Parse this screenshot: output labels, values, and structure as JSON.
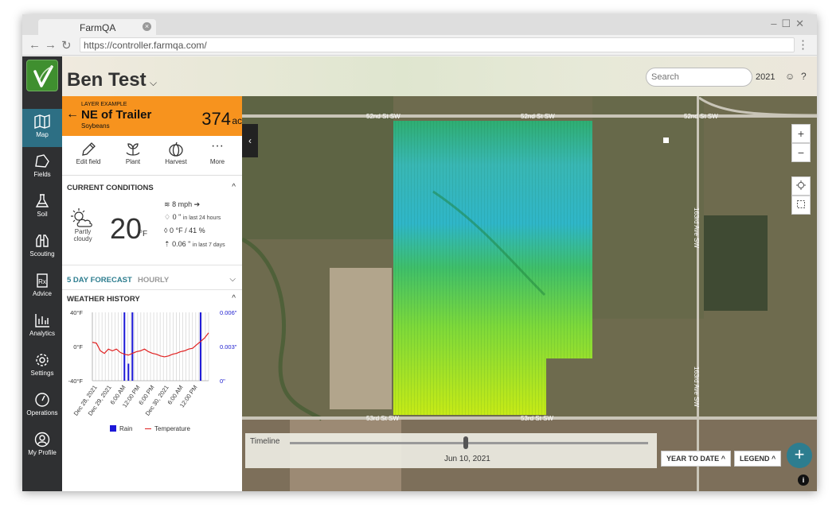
{
  "browser": {
    "tab_title": "FarmQA",
    "url": "https://controller.farmqa.com/"
  },
  "sidebar": {
    "items": [
      {
        "label": "Map",
        "icon": "map-icon",
        "active": true
      },
      {
        "label": "Fields",
        "icon": "fields-icon"
      },
      {
        "label": "Soil",
        "icon": "flask-icon"
      },
      {
        "label": "Scouting",
        "icon": "binoculars-icon"
      },
      {
        "label": "Advice",
        "icon": "prescription-icon"
      },
      {
        "label": "Analytics",
        "icon": "bar-chart-icon"
      },
      {
        "label": "Settings",
        "icon": "gear-icon"
      },
      {
        "label": "Operations",
        "icon": "gauge-icon"
      },
      {
        "label": "My Profile",
        "icon": "user-icon"
      }
    ]
  },
  "header": {
    "title": "Ben Test",
    "search_placeholder": "Search",
    "year": "2021"
  },
  "field": {
    "layer_label": "LAYER EXAMPLE",
    "name": "NE of Trailer",
    "crop": "Soybeans",
    "acres": "374",
    "acres_unit": "ac"
  },
  "actions": [
    {
      "label": "Edit field",
      "icon": "pencil-icon"
    },
    {
      "label": "Plant",
      "icon": "sprout-icon"
    },
    {
      "label": "Harvest",
      "icon": "pumpkin-icon"
    },
    {
      "label": "More",
      "icon": "more-icon"
    }
  ],
  "conditions": {
    "title": "CURRENT CONDITIONS",
    "sky": "Partly cloudy",
    "temp": "20",
    "temp_unit": "°F",
    "wind": "8 mph",
    "rain": "0 \"",
    "rain_note": "in last 24 hours",
    "dew": "0 °F / 41 %",
    "et": "0.06 \"",
    "et_note": "in last 7 days"
  },
  "forecast": {
    "tab_active": "5 DAY FORECAST",
    "tab_inactive": "HOURLY"
  },
  "history": {
    "title": "WEATHER HISTORY"
  },
  "chart_data": {
    "type": "line",
    "title": "WEATHER HISTORY",
    "categories": [
      "Dec 28, 2021",
      "Dec 29, 2021",
      "6:00 AM",
      "12:00 PM",
      "6:00 PM",
      "Dec 30, 2021",
      "6:00 AM",
      "12:00 PM"
    ],
    "y_left": {
      "ticks": [
        "40°F",
        "0°F",
        "-40°F"
      ],
      "range": [
        -40,
        40
      ]
    },
    "y_right": {
      "ticks": [
        "0.006\"",
        "0.003\"",
        "0\""
      ],
      "range": [
        0,
        0.006
      ]
    },
    "series": [
      {
        "name": "Temperature",
        "color": "#e02020",
        "y": [
          5,
          4,
          -5,
          -8,
          -3,
          -5,
          -3,
          -7,
          -9,
          -10,
          -8,
          -6,
          -5,
          -3,
          -6,
          -8,
          -9,
          -11,
          -12,
          -11,
          -9,
          -8,
          -6,
          -5,
          -3,
          -2,
          2,
          6,
          10,
          16
        ]
      },
      {
        "name": "Rain",
        "color": "#1c18d8",
        "y": [
          0,
          0,
          0,
          0,
          0,
          0,
          0,
          0,
          0.006,
          0.0015,
          0.006,
          0,
          0,
          0,
          0,
          0,
          0,
          0,
          0,
          0,
          0,
          0,
          0,
          0,
          0,
          0,
          0,
          0.006,
          0,
          0
        ]
      }
    ],
    "grid": true,
    "legend": "bottom"
  },
  "legend": {
    "rain": "Rain",
    "temperature": "Temperature",
    "rain_color": "#1c18d8",
    "temp_color": "#e02020"
  },
  "map": {
    "roads": [
      "52nd St SW",
      "52nd St SW",
      "52nd St SW",
      "53rd St SW",
      "53rd St SW",
      "163rd Ave SW",
      "163rd Ave SW"
    ],
    "timeline_label": "Timeline",
    "timeline_date": "Jun 10, 2021",
    "timeline_position": 0.49,
    "year_to_date": "YEAR TO DATE",
    "legend_btn": "LEGEND",
    "zoom_in": "+",
    "zoom_out": "−"
  }
}
